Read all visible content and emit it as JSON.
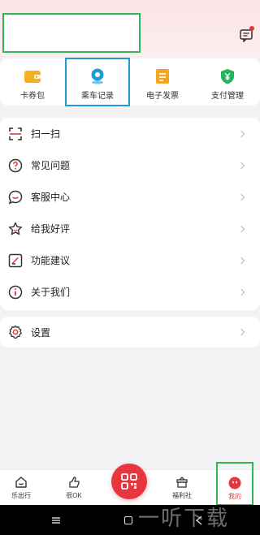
{
  "quick_actions": [
    {
      "label": "卡券包",
      "icon": "wallet-icon",
      "color": "#f3b21d"
    },
    {
      "label": "乘车记录",
      "icon": "location-pin-icon",
      "color": "#1f9ad8"
    },
    {
      "label": "电子发票",
      "icon": "invoice-icon",
      "color": "#f3a51d"
    },
    {
      "label": "支付管理",
      "icon": "yuan-shield-icon",
      "color": "#25b05a"
    }
  ],
  "menu": [
    {
      "label": "扫一扫",
      "icon": "scan-icon"
    },
    {
      "label": "常见问题",
      "icon": "question-icon"
    },
    {
      "label": "客服中心",
      "icon": "chat-smile-icon"
    },
    {
      "label": "给我好评",
      "icon": "star-icon"
    },
    {
      "label": "功能建议",
      "icon": "edit-icon"
    },
    {
      "label": "关于我们",
      "icon": "info-icon"
    }
  ],
  "settings": {
    "label": "设置",
    "icon": "settings-icon"
  },
  "tabs": [
    {
      "label": "乐出行",
      "icon": "home-icon"
    },
    {
      "label": "很OK",
      "icon": "thumbs-up-icon"
    },
    {
      "label": "福利社",
      "icon": "gift-box-icon"
    },
    {
      "label": "我的",
      "icon": "user-face-icon"
    }
  ],
  "watermark": "一听下载",
  "colors": {
    "accent": "#e8363f",
    "highlight_box": "#2fb552",
    "selected_box": "#1f9ad8"
  }
}
